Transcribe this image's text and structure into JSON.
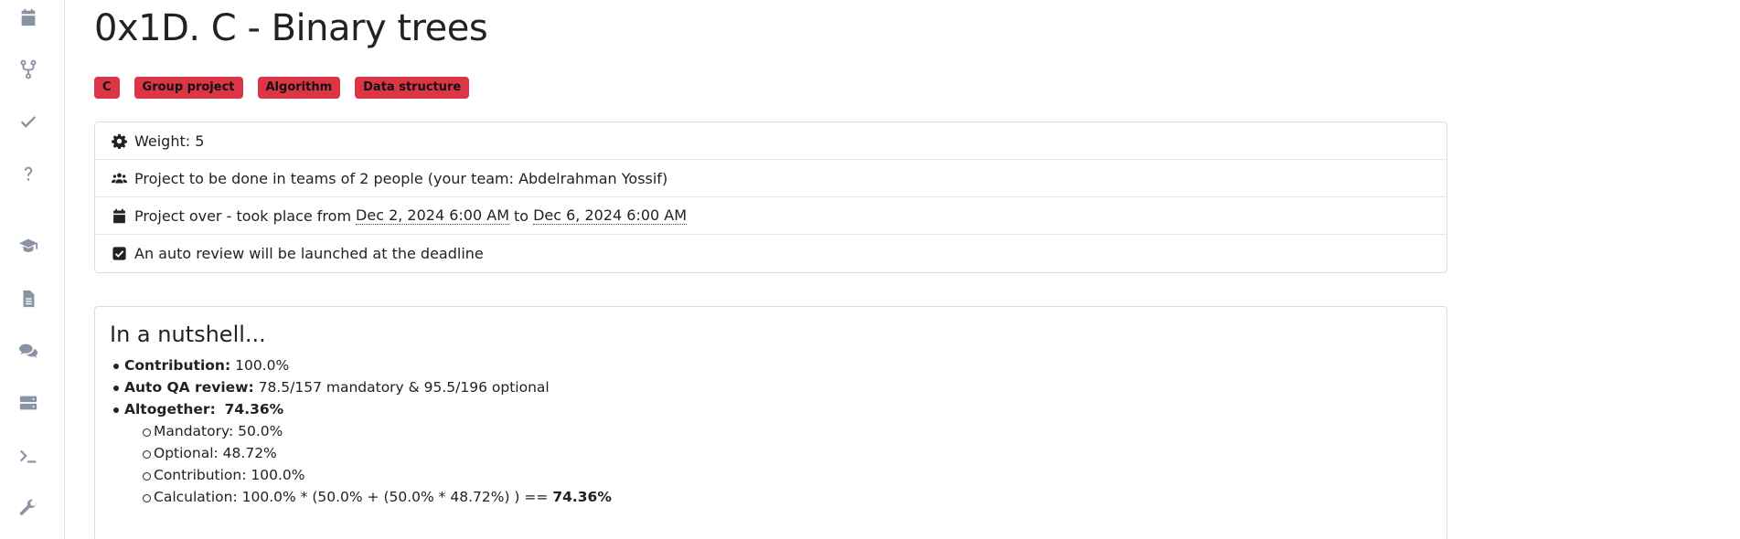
{
  "sidebar": {
    "icons": [
      "calendar-icon",
      "fork-icon",
      "check-icon",
      "question-icon",
      "graduation-cap-icon",
      "file-icon",
      "chat-icon",
      "server-icon",
      "terminal-icon",
      "wrench-icon"
    ]
  },
  "project": {
    "title": "0x1D. C - Binary trees",
    "tags": [
      "C",
      "Group project",
      "Algorithm",
      "Data structure"
    ],
    "weight": "Weight: 5",
    "team": "Project to be done in teams of 2 people (your team: Abdelrahman Yossif)",
    "schedule_prefix": "Project over - took place from",
    "start_date": "Dec 2, 2024 6:00 AM",
    "to_label": "to",
    "end_date": "Dec 6, 2024 6:00 AM",
    "auto_review": "An auto review will be launched at the deadline"
  },
  "nutshell": {
    "heading": "In a nutshell...",
    "contribution_label": "Contribution:",
    "contribution_value": "100.0%",
    "qa_label": "Auto QA review:",
    "qa_value": "78.5/157 mandatory & 95.5/196 optional",
    "altogether_label": "Altogether:",
    "altogether_value": "74.36%",
    "mandatory": "Mandatory: 50.0%",
    "optional": "Optional: 48.72%",
    "contribution_sub": "Contribution: 100.0%",
    "calculation": "Calculation:  100.0% * (50.0% + (50.0% * 48.72%) )  ==",
    "calculation_result": "74.36%"
  },
  "colors": {
    "tag_background": "#dc3545",
    "sidebar_icon": "#8a93a6"
  }
}
